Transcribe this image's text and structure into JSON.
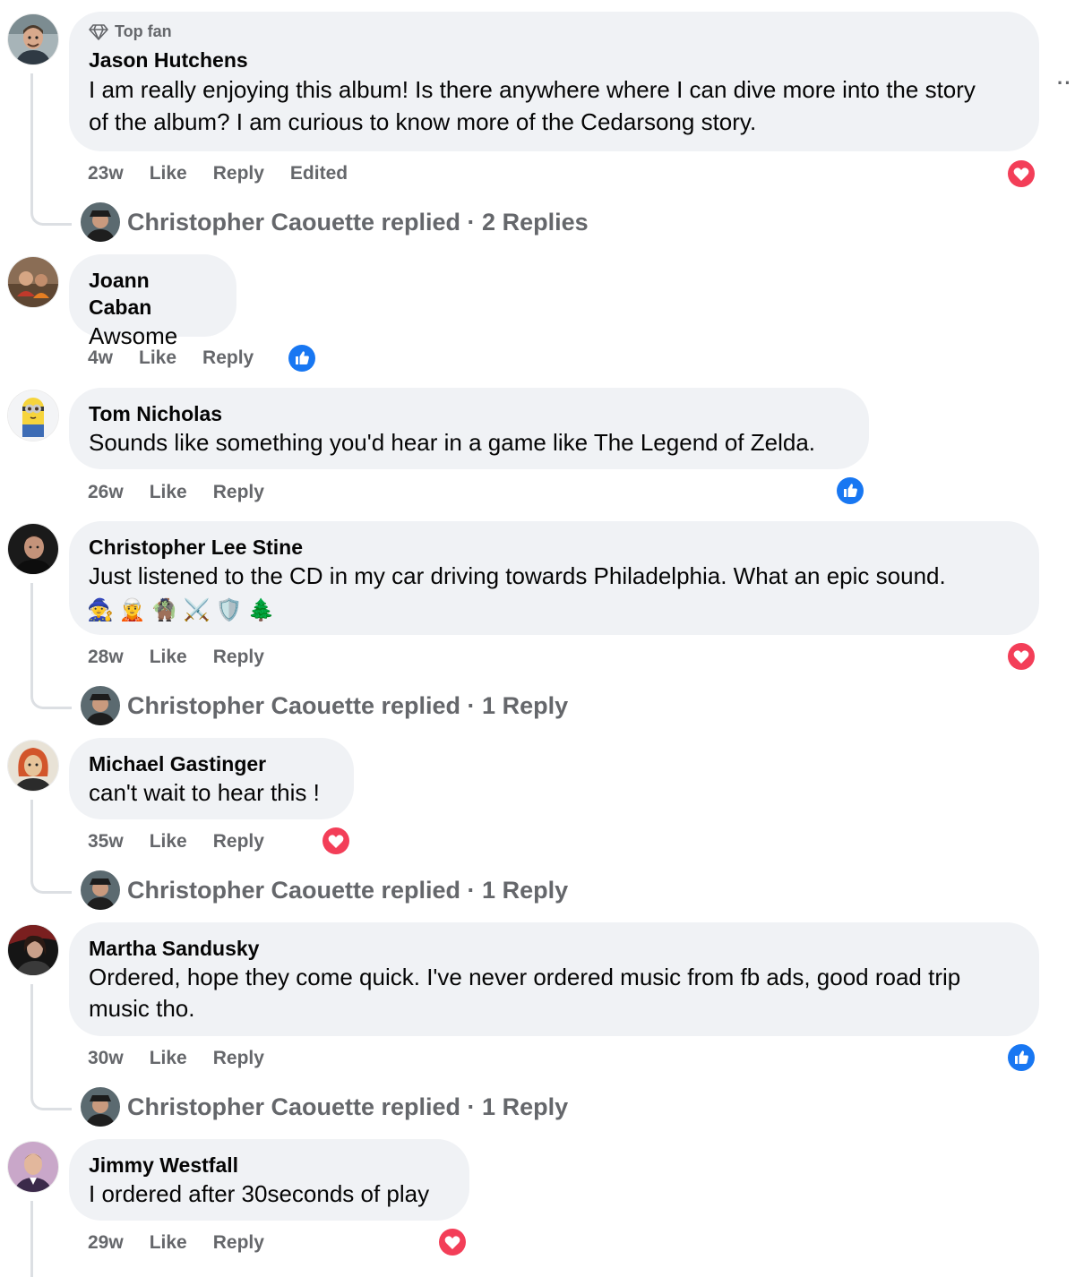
{
  "comments": [
    {
      "badge": "Top fan",
      "author": "Jason Hutchens",
      "text_lines": [
        "I am really enjoying this album! Is there anywhere where I can dive more into the story",
        "of the album? I am curious to know more of the Cedarsong story."
      ],
      "time": "23w",
      "like": "Like",
      "reply": "Reply",
      "edited": "Edited",
      "reaction": "love-reaction",
      "replied": "Christopher Caouette replied · 2 Replies"
    },
    {
      "author": "Joann Caban",
      "text_lines": [
        "Awsome"
      ],
      "time": "4w",
      "like": "Like",
      "reply": "Reply",
      "reaction": "like-reaction"
    },
    {
      "author": "Tom Nicholas",
      "text_lines": [
        "Sounds like something you'd hear in a game like The Legend of Zelda."
      ],
      "time": "26w",
      "like": "Like",
      "reply": "Reply",
      "reaction": "like-reaction"
    },
    {
      "author": "Christopher Lee Stine",
      "text_lines": [
        "Just listened to the CD in my car driving towards Philadelphia. What an epic sound."
      ],
      "emojis": [
        "🧙",
        "🧝",
        "🧌",
        "⚔️",
        "🛡️",
        "🌲"
      ],
      "time": "28w",
      "like": "Like",
      "reply": "Reply",
      "reaction": "love-reaction",
      "replied": "Christopher Caouette replied · 1 Reply"
    },
    {
      "author": "Michael Gastinger",
      "text_lines": [
        "can't wait to hear this !"
      ],
      "time": "35w",
      "like": "Like",
      "reply": "Reply",
      "reaction": "love-reaction",
      "replied": "Christopher Caouette replied · 1 Reply"
    },
    {
      "author": "Martha Sandusky",
      "text_lines": [
        "Ordered, hope they come quick. I've never ordered music from fb ads, good road trip",
        "music tho."
      ],
      "time": "30w",
      "like": "Like",
      "reply": "Reply",
      "reaction": "like-reaction",
      "replied": "Christopher Caouette replied · 1 Reply"
    },
    {
      "author": "Jimmy Westfall",
      "text_lines": [
        "I ordered after 30seconds of play"
      ],
      "time": "29w",
      "like": "Like",
      "reply": "Reply",
      "reaction": "love-reaction"
    }
  ],
  "more_dots": "··",
  "colors": {
    "bubble": "#f0f2f5",
    "meta_text": "#65676b",
    "love": "#f33e58",
    "like": "#1877f2",
    "thread_line": "#dcdfe3"
  }
}
